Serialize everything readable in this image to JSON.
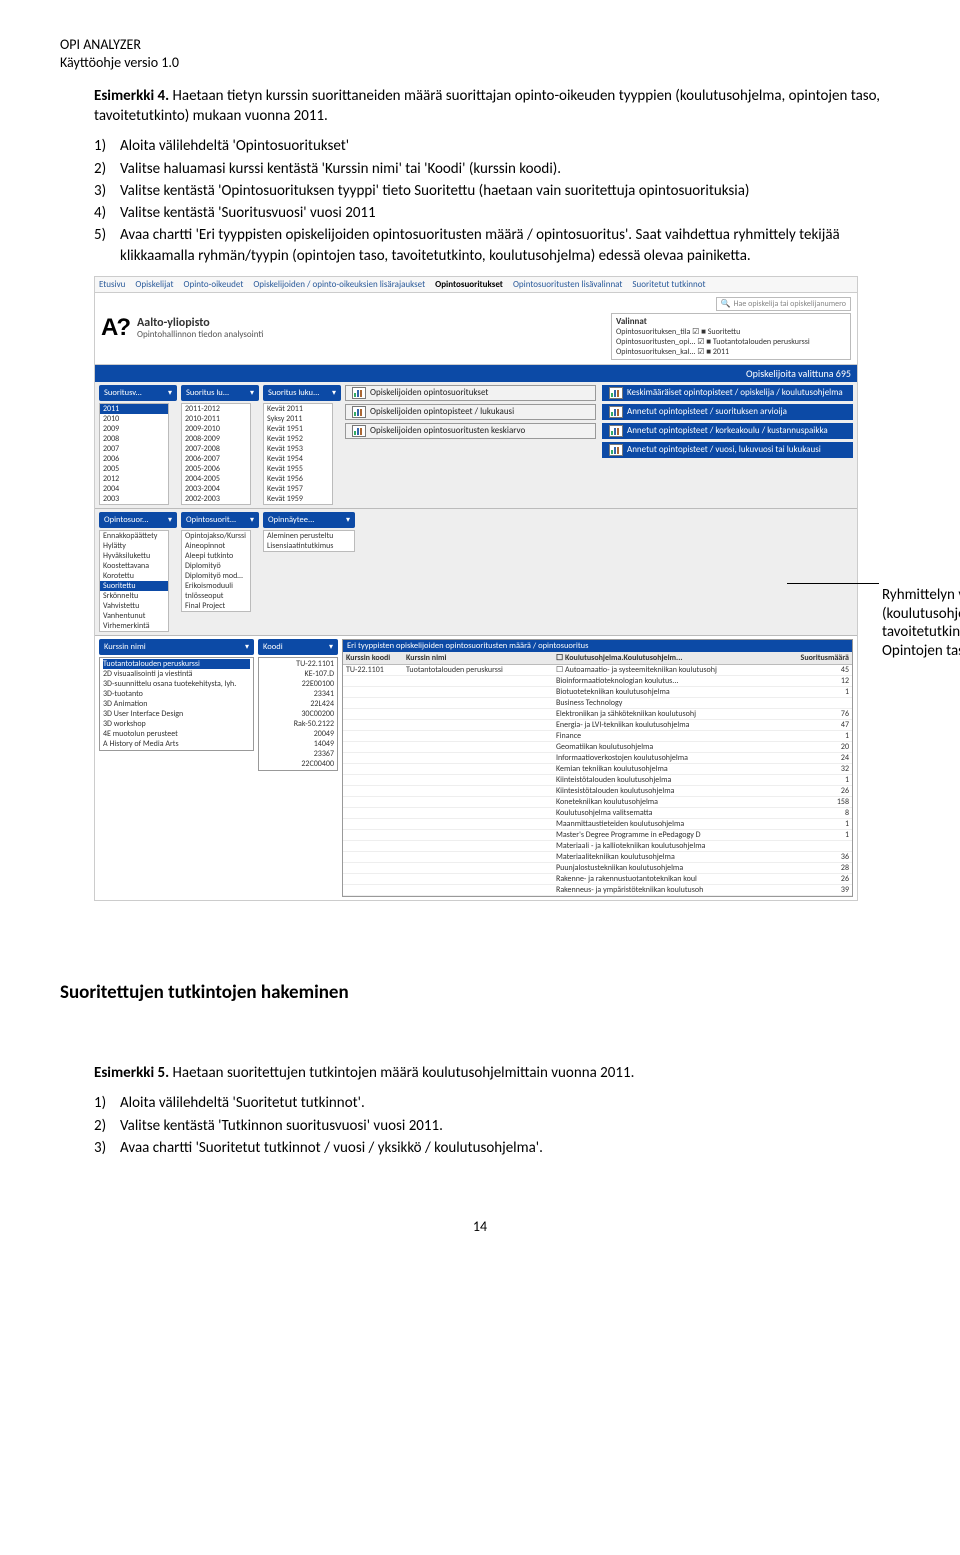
{
  "header": {
    "product": "OPI ANALYZER",
    "version": "Käyttöohje versio 1.0"
  },
  "ex4": {
    "lead": "Esimerkki 4.",
    "rest": " Haetaan tietyn kurssin suorittaneiden määrä suorittajan opinto-oikeuden tyyppien (koulutusohjelma, opintojen taso, tavoitetutkinto) mukaan vuonna 2011.",
    "steps": [
      "Aloita välilehdeltä 'Opintosuoritukset'",
      "Valitse haluamasi kurssi kentästä 'Kurssin nimi' tai 'Koodi' (kurssin koodi).",
      "Valitse kentästä 'Opintosuorituksen tyyppi' tieto Suoritettu (haetaan vain suoritettuja opintosuorituksia)",
      "Valitse kentästä 'Suoritusvuosi' vuosi 2011",
      "Avaa chartti 'Eri tyyppisten opiskelijoiden opintosuoritusten määrä / opintosuoritus'. Saat vaihdettua ryhmittely tekijää klikkaamalla ryhmän/tyypin (opintojen taso, tavoitetutkinto, koulutusohjelma) edessä olevaa painiketta."
    ]
  },
  "callout": "Ryhmittelyn vaihtaminen (koulutusohjelma, tavoitetutkinto, Opintojen taso",
  "section2": "Suoritettujen tutkintojen hakeminen",
  "ex5": {
    "lead": "Esimerkki 5.",
    "rest": " Haetaan suoritettujen tutkintojen määrä koulutusohjelmittain vuonna 2011.",
    "steps": [
      "Aloita välilehdeltä 'Suoritetut tutkinnot'.",
      "Valitse kentästä 'Tutkinnon suoritusvuosi' vuosi 2011.",
      "Avaa chartti 'Suoritetut tutkinnot / vuosi / yksikkö / koulutusohjelma'."
    ]
  },
  "pagenum": "14",
  "shot": {
    "tabs": [
      "Etusivu",
      "Opiskelijat",
      "Opinto-oikeudet",
      "Opiskelijoiden / opinto-oikeuksien lisärajaukset",
      "Opintosuoritukset",
      "Opintosuoritusten lisävalinnat",
      "Suoritetut tutkinnot"
    ],
    "brand": {
      "name": "Aalto-yliopisto",
      "sub": "Opintohallinnon tiedon analysointi"
    },
    "search_placeholder": "Hae opiskelija tai opiskelijanumero",
    "valinnat": {
      "title": "Valinnat",
      "rows": [
        "Opintosuorituksen_tila     ☑  ■  Suoritettu",
        "Opintosuoritusten_opi...   ☑  ■  Tuotantotalouden peruskurssi",
        "Opintosuorituksen_kal...   ☑  ■  2011"
      ]
    },
    "countbar": "Opiskelijoita valittuna 695",
    "topfilters": {
      "v": {
        "pill": "Suoritusv...",
        "list": [
          "2011",
          "2010",
          "2009",
          "2008",
          "2007",
          "2006",
          "2005",
          "2012",
          "2004",
          "2003"
        ],
        "sel": 0
      },
      "lv": {
        "pill": "Suoritus lu...",
        "list": [
          "2011-2012",
          "2010-2011",
          "2009-2010",
          "2008-2009",
          "2007-2008",
          "2006-2007",
          "2005-2006",
          "2004-2005",
          "2003-2004",
          "2002-2003"
        ]
      },
      "lk": {
        "pill": "Suoritus luku...",
        "list": [
          "Kevät 2011",
          "Syksy 2011",
          "Kevät 1951",
          "Kevät 1952",
          "Kevät 1953",
          "Kevät 1954",
          "Kevät 1955",
          "Kevät 1956",
          "Kevät 1957",
          "Kevät 1959"
        ]
      }
    },
    "chartbtns_left": [
      "Opiskelijoiden opintosuoritukset",
      "Opiskelijoiden opintopisteet / lukukausi",
      "Opiskelijoiden opintosuoritusten keskiarvo"
    ],
    "chartbtns_right": [
      "Keskimääräiset opintopisteet / opiskelija / koulutusohjelma",
      "Annetut opintopisteet / suorituksen arvioija",
      "Annetut opintopisteet / korkeakoulu / kustannuspaikka",
      "Annetut opintopisteet / vuosi, lukuvuosi tai lukukausi"
    ],
    "mid": {
      "os": {
        "pill": "Opintosuor...",
        "list": [
          "Ennakkopäättety",
          "Hylätty",
          "Hyväksilukettu",
          "Koostettavana",
          "Korotettu",
          "Suoritettu",
          "Srkönneltu",
          "Vahvistettu",
          "Vanhentunut",
          "Virhemerkintä"
        ],
        "sel": 5
      },
      "os2": {
        "pill": "Opintosuorit...",
        "list": [
          "Opintojakso/Kurssi",
          "Aineopinnot",
          "Aleepi tutkinto",
          "Diplomityö",
          "Diplomityö moduuli",
          "Erikoismoduuli",
          "tnlösseoput",
          "Final Project"
        ]
      },
      "on": {
        "pill": "Opinnäytee...",
        "list": [
          "Aleminen perusteltu",
          "",
          "Lisensiaatintutkimus"
        ]
      }
    },
    "kurssi": {
      "pill": "Kurssin nimi",
      "sel": "Tuotantotalouden peruskurssi",
      "list": [
        "2D visuaalisointi ja viestintä",
        "3D-suunnittelu osana tuotekehitysta, lyh.",
        "3D-tuotanto",
        "3D Animation",
        "3D User Interface Design",
        "3D workshop",
        "4E muotolun perusteet",
        "A History of Media Arts"
      ]
    },
    "koodi": {
      "pill": "Koodi",
      "list": [
        "TU-22.1101",
        "KE-107.D",
        "22E00100",
        "23341",
        "22L424",
        "30C00200",
        "Rak-50.2122",
        "20049",
        "14049",
        "23367",
        "22C00400"
      ]
    },
    "datatable": {
      "title": "Eri tyyppisten opiskelijoiden opintosuoritusten määrä / opintosuoritus",
      "headers": [
        "Kurssin koodi",
        "Kurssin nimi",
        "☐ Koulutusohjelma.Koulutusohjelm...",
        "Suoritusmäärä"
      ],
      "first": [
        "TU-22.1101",
        "Tuotantotalouden peruskurssi",
        "☐ Autoamaatio- ja systeemitekniikan koulutusohj",
        "45"
      ],
      "rows": [
        [
          "Bioinformaatioteknologian koulutus...",
          "12"
        ],
        [
          "Biotuotetekniikan koulutusohjelma",
          "1"
        ],
        [
          "Business Technology",
          ""
        ],
        [
          "Elektroniikan ja sähkötekniikan koulutusohj",
          "76"
        ],
        [
          "Energia- ja LVI-tekniikan koulutusohjelma",
          "47"
        ],
        [
          "Finance",
          "1"
        ],
        [
          "Geomatiikan koulutusohjelma",
          "20"
        ],
        [
          "Informaatioverkostojen koulutusohjelma",
          "24"
        ],
        [
          "Kemian tekniikan koulutusohjelma",
          "32"
        ],
        [
          "Kiinteistötalouden koulutusohjelma",
          "1"
        ],
        [
          "Kiintesistötalouden koulutusohjelma",
          "26"
        ],
        [
          "Konetekniikan koulutusohjelma",
          "158"
        ],
        [
          "Koulutusohjelma valitsematta",
          "8"
        ],
        [
          "Maanmittaustieteiden koulutusohjelma",
          "1"
        ],
        [
          "Master's Degree Programme in ePedagogy D",
          "1"
        ],
        [
          "Materiaali - ja kalliotekniikan koulutusohjelma",
          ""
        ],
        [
          "Materiaalitekniikan koulutusohjelma",
          "36"
        ],
        [
          "Puunjalostustekniikan koulutusohjelma",
          "28"
        ],
        [
          "Rakenne- ja rakennustuotantoteknikan koul",
          "26"
        ],
        [
          "Rakenneus- ja ympäristötekniikan koulutusoh",
          "39"
        ]
      ]
    }
  }
}
